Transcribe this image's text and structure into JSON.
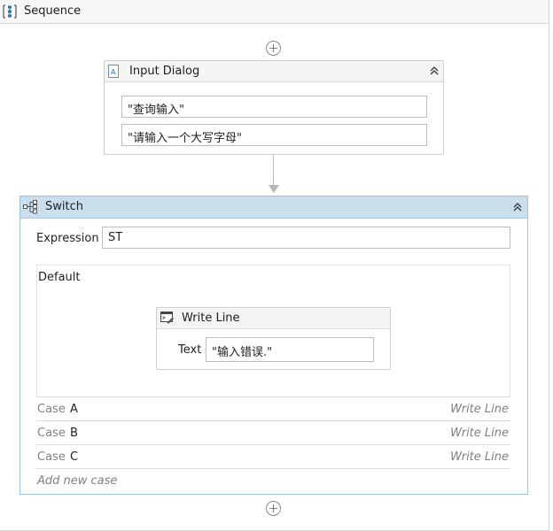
{
  "sequence": {
    "title": "Sequence",
    "icon": "sequence-icon"
  },
  "input_dialog": {
    "title": "Input Dialog",
    "icon": "input-dialog-icon",
    "title_field": "\"查询输入\"",
    "label_field": "\"请输入一个大写字母\""
  },
  "switch": {
    "title": "Switch",
    "icon": "switch-icon",
    "expression_label": "Expression",
    "expression_value": "ST",
    "default_label": "Default",
    "write_line": {
      "title": "Write Line",
      "icon": "write-line-icon",
      "text_label": "Text",
      "text_value": "\"输入错误.\""
    },
    "cases": [
      {
        "label": "Case",
        "value": "A",
        "target": "Write Line"
      },
      {
        "label": "Case",
        "value": "B",
        "target": "Write Line"
      },
      {
        "label": "Case",
        "value": "C",
        "target": "Write Line"
      }
    ],
    "add_case_label": "Add new case"
  },
  "colors": {
    "switch_header": "#c9dfee",
    "switch_border": "#9ec4dd",
    "sequence_icon": "#2e6fb3"
  }
}
